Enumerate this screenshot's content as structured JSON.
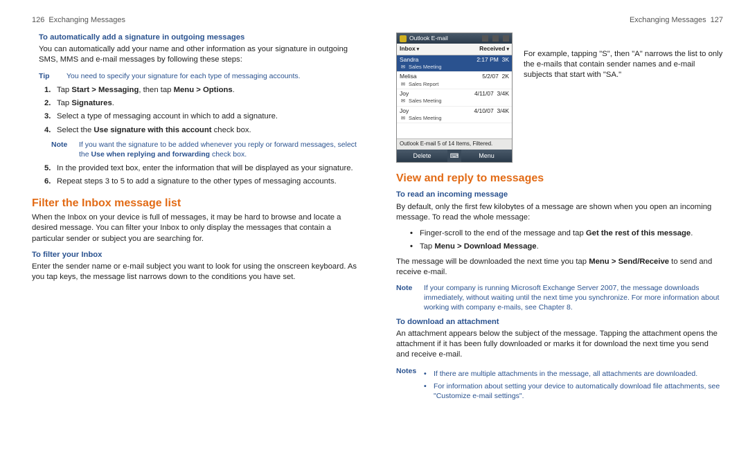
{
  "left": {
    "pageNum": "126",
    "running": "Exchanging Messages",
    "sub1": "To automatically add a signature in outgoing messages",
    "intro": "You can automatically add your name and other information as your signature in outgoing SMS, MMS and e-mail messages by following these steps:",
    "tip": {
      "label": "Tip",
      "text": "You need to specify your signature for each type of messaging accounts."
    },
    "steps": [
      {
        "n": "1.",
        "pre": "Tap ",
        "b1": "Start > Messaging",
        "mid": ", then tap ",
        "b2": "Menu > Options",
        "post": "."
      },
      {
        "n": "2.",
        "pre": "Tap ",
        "b1": "Signatures",
        "post": "."
      },
      {
        "n": "3.",
        "plain": "Select a type of messaging account in which to add a signature."
      },
      {
        "n": "4.",
        "pre": "Select the ",
        "b1": "Use signature with this account",
        "post": " check box."
      }
    ],
    "noteAfter4": {
      "label": "Note",
      "text1": "If you want the signature to be added whenever you reply or forward messages, select the ",
      "bold": "Use when replying and forwarding",
      "text2": " check box."
    },
    "steps2": [
      {
        "n": "5.",
        "plain": "In the provided text box, enter the information that will be displayed as your signature."
      },
      {
        "n": "6.",
        "plain": "Repeat steps 3 to 5 to add a signature to the other types of messaging accounts."
      }
    ],
    "h1a": "Filter the Inbox message list",
    "filterIntro": "When the Inbox on your device is full of messages, it may be hard to browse and locate a desired message. You can filter your Inbox to only display the messages that contain a particular sender or subject you are searching for.",
    "sub2": "To filter your Inbox",
    "filterBody": "Enter the sender name or e-mail subject you want to look for using the onscreen keyboard. As you tap keys, the message list narrows down to the conditions you have set."
  },
  "right": {
    "pageNum": "127",
    "running": "Exchanging Messages",
    "caption": "For example, tapping \"S\", then \"A\" narrows the list to only the e-mails that contain sender names and e-mail subjects that start with \"SA.\"",
    "screenshot": {
      "title": "Outlook E-mail",
      "col1": "Inbox",
      "col2": "Received",
      "rows": [
        {
          "from": "Sandra",
          "date": "2:17 PM",
          "size": "3K",
          "subj": "Sales Meeting",
          "sel": true
        },
        {
          "from": "Melisa",
          "date": "5/2/07",
          "size": "2K",
          "subj": "Sales Report"
        },
        {
          "from": "Joy",
          "date": "4/11/07",
          "size": "3/4K",
          "subj": "Sales Meeting"
        },
        {
          "from": "Joy",
          "date": "4/10/07",
          "size": "3/4K",
          "subj": "Sales Meeting"
        }
      ],
      "status": "Outlook E-mail 5 of 14 Items, Filtered.",
      "softLeft": "Delete",
      "softRight": "Menu"
    },
    "h1b": "View and reply to messages",
    "sub3": "To read an incoming message",
    "readIntro": "By default, only the first few kilobytes of a message are shown when you open an incoming message. To read the whole message:",
    "readBullets": [
      {
        "pre": "Finger-scroll to the end of the message and tap ",
        "b": "Get the rest of this message",
        "post": "."
      },
      {
        "pre": "Tap ",
        "b": "Menu > Download Message",
        "post": "."
      }
    ],
    "readPost1a": "The message will be downloaded the next time you tap ",
    "readPost1b": "Menu > Send/Receive",
    "readPost1c": " to send and receive e-mail.",
    "note2": {
      "label": "Note",
      "text": "If your company is running Microsoft Exchange Server 2007, the message downloads immediately, without waiting until the next time you synchronize. For more information about working with company e-mails, see Chapter 8."
    },
    "sub4": "To download an attachment",
    "attBody": "An attachment appears below the subject of the message. Tapping the attachment opens the attachment if it has been fully downloaded or marks it for download the next time you send and receive e-mail.",
    "notes": {
      "label": "Notes",
      "items": [
        "If there are multiple attachments in the message, all attachments are downloaded.",
        "For information about setting your device to automatically download file attachments, see \"Customize e-mail settings\"."
      ]
    }
  }
}
